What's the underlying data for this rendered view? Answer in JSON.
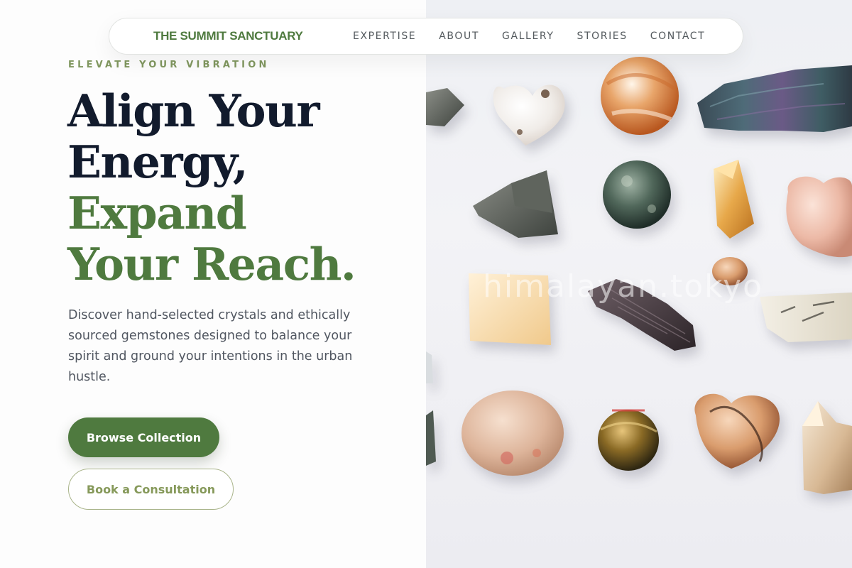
{
  "nav": {
    "brand": "THE SUMMIT SANCTUARY",
    "links": [
      "EXPERTISE",
      "ABOUT",
      "GALLERY",
      "STORIES",
      "CONTACT"
    ]
  },
  "hero": {
    "eyebrow": "ELEVATE YOUR VIBRATION",
    "headline_lines": [
      "Align Your",
      "Energy,",
      "Expand",
      "Your Reach."
    ],
    "description": "Discover hand-selected crystals and ethically sourced gemstones designed to balance your spirit and ground your intentions in the urban hustle.",
    "primary_button": "Browse Collection",
    "secondary_button": "Book a Consultation"
  },
  "image": {
    "watermark": "himalayan.tokyo"
  },
  "colors": {
    "brand_green": "#4f7a3f",
    "eyebrow_green": "#80975f",
    "headline_dark": "#121b2d",
    "body_text": "#505660"
  }
}
